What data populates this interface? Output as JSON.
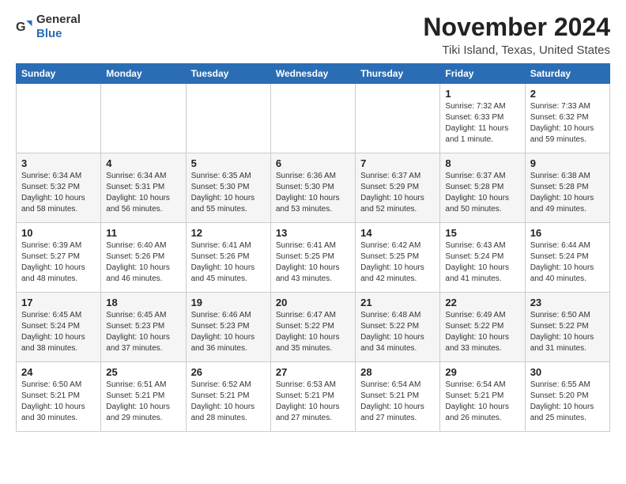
{
  "logo": {
    "general": "General",
    "blue": "Blue",
    "icon_color": "#2a6db5"
  },
  "title": "November 2024",
  "subtitle": "Tiki Island, Texas, United States",
  "days_of_week": [
    "Sunday",
    "Monday",
    "Tuesday",
    "Wednesday",
    "Thursday",
    "Friday",
    "Saturday"
  ],
  "weeks": [
    [
      {
        "day": "",
        "info": ""
      },
      {
        "day": "",
        "info": ""
      },
      {
        "day": "",
        "info": ""
      },
      {
        "day": "",
        "info": ""
      },
      {
        "day": "",
        "info": ""
      },
      {
        "day": "1",
        "info": "Sunrise: 7:32 AM\nSunset: 6:33 PM\nDaylight: 11 hours and 1 minute."
      },
      {
        "day": "2",
        "info": "Sunrise: 7:33 AM\nSunset: 6:32 PM\nDaylight: 10 hours and 59 minutes."
      }
    ],
    [
      {
        "day": "3",
        "info": "Sunrise: 6:34 AM\nSunset: 5:32 PM\nDaylight: 10 hours and 58 minutes."
      },
      {
        "day": "4",
        "info": "Sunrise: 6:34 AM\nSunset: 5:31 PM\nDaylight: 10 hours and 56 minutes."
      },
      {
        "day": "5",
        "info": "Sunrise: 6:35 AM\nSunset: 5:30 PM\nDaylight: 10 hours and 55 minutes."
      },
      {
        "day": "6",
        "info": "Sunrise: 6:36 AM\nSunset: 5:30 PM\nDaylight: 10 hours and 53 minutes."
      },
      {
        "day": "7",
        "info": "Sunrise: 6:37 AM\nSunset: 5:29 PM\nDaylight: 10 hours and 52 minutes."
      },
      {
        "day": "8",
        "info": "Sunrise: 6:37 AM\nSunset: 5:28 PM\nDaylight: 10 hours and 50 minutes."
      },
      {
        "day": "9",
        "info": "Sunrise: 6:38 AM\nSunset: 5:28 PM\nDaylight: 10 hours and 49 minutes."
      }
    ],
    [
      {
        "day": "10",
        "info": "Sunrise: 6:39 AM\nSunset: 5:27 PM\nDaylight: 10 hours and 48 minutes."
      },
      {
        "day": "11",
        "info": "Sunrise: 6:40 AM\nSunset: 5:26 PM\nDaylight: 10 hours and 46 minutes."
      },
      {
        "day": "12",
        "info": "Sunrise: 6:41 AM\nSunset: 5:26 PM\nDaylight: 10 hours and 45 minutes."
      },
      {
        "day": "13",
        "info": "Sunrise: 6:41 AM\nSunset: 5:25 PM\nDaylight: 10 hours and 43 minutes."
      },
      {
        "day": "14",
        "info": "Sunrise: 6:42 AM\nSunset: 5:25 PM\nDaylight: 10 hours and 42 minutes."
      },
      {
        "day": "15",
        "info": "Sunrise: 6:43 AM\nSunset: 5:24 PM\nDaylight: 10 hours and 41 minutes."
      },
      {
        "day": "16",
        "info": "Sunrise: 6:44 AM\nSunset: 5:24 PM\nDaylight: 10 hours and 40 minutes."
      }
    ],
    [
      {
        "day": "17",
        "info": "Sunrise: 6:45 AM\nSunset: 5:24 PM\nDaylight: 10 hours and 38 minutes."
      },
      {
        "day": "18",
        "info": "Sunrise: 6:45 AM\nSunset: 5:23 PM\nDaylight: 10 hours and 37 minutes."
      },
      {
        "day": "19",
        "info": "Sunrise: 6:46 AM\nSunset: 5:23 PM\nDaylight: 10 hours and 36 minutes."
      },
      {
        "day": "20",
        "info": "Sunrise: 6:47 AM\nSunset: 5:22 PM\nDaylight: 10 hours and 35 minutes."
      },
      {
        "day": "21",
        "info": "Sunrise: 6:48 AM\nSunset: 5:22 PM\nDaylight: 10 hours and 34 minutes."
      },
      {
        "day": "22",
        "info": "Sunrise: 6:49 AM\nSunset: 5:22 PM\nDaylight: 10 hours and 33 minutes."
      },
      {
        "day": "23",
        "info": "Sunrise: 6:50 AM\nSunset: 5:22 PM\nDaylight: 10 hours and 31 minutes."
      }
    ],
    [
      {
        "day": "24",
        "info": "Sunrise: 6:50 AM\nSunset: 5:21 PM\nDaylight: 10 hours and 30 minutes."
      },
      {
        "day": "25",
        "info": "Sunrise: 6:51 AM\nSunset: 5:21 PM\nDaylight: 10 hours and 29 minutes."
      },
      {
        "day": "26",
        "info": "Sunrise: 6:52 AM\nSunset: 5:21 PM\nDaylight: 10 hours and 28 minutes."
      },
      {
        "day": "27",
        "info": "Sunrise: 6:53 AM\nSunset: 5:21 PM\nDaylight: 10 hours and 27 minutes."
      },
      {
        "day": "28",
        "info": "Sunrise: 6:54 AM\nSunset: 5:21 PM\nDaylight: 10 hours and 27 minutes."
      },
      {
        "day": "29",
        "info": "Sunrise: 6:54 AM\nSunset: 5:21 PM\nDaylight: 10 hours and 26 minutes."
      },
      {
        "day": "30",
        "info": "Sunrise: 6:55 AM\nSunset: 5:20 PM\nDaylight: 10 hours and 25 minutes."
      }
    ]
  ]
}
